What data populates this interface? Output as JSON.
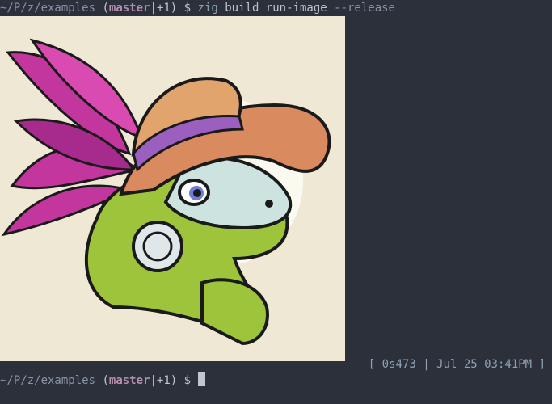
{
  "terminal": {
    "top_line": {
      "path": "~/P/z/examples",
      "branch": "master",
      "branch_extra": "|+1",
      "dollar": "$",
      "command": "zig",
      "args": "build run-image",
      "option": "--release"
    },
    "image": {
      "subject": "iguana-with-feathered-hat",
      "colors": {
        "background": "#eee8d5",
        "skin_green": "#9dc43a",
        "hat_brim": "#d98b5f",
        "hat_band": "#9b5fc0",
        "feathers": "#c2369e"
      }
    },
    "status": {
      "open_bracket": "[",
      "duration": "0s473",
      "separator": "|",
      "timestamp": "Jul 25 03:41PM",
      "close_bracket": "]"
    },
    "bottom_prompt": {
      "path": "~/P/z/examples",
      "branch": "master",
      "branch_extra": "|+1",
      "dollar": "$"
    }
  }
}
